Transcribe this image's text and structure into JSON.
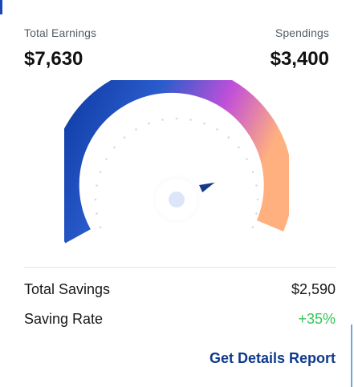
{
  "earnings": {
    "label": "Total Earnings",
    "value": "$7,630"
  },
  "spendings": {
    "label": "Spendings",
    "value": "$3,400"
  },
  "gauge": {
    "level": 0.8,
    "colors": {
      "start": "#0f3fa6",
      "mid": "#2f5fcf",
      "accent": "#c14fd8",
      "end": "#ffae80",
      "needle": "#153a8c",
      "hub": "#dfe8fa"
    }
  },
  "summary": {
    "total_savings_label": "Total Savings",
    "total_savings_value": "$2,590",
    "saving_rate_label": "Saving Rate",
    "saving_rate_value": "+35%"
  },
  "actions": {
    "details_report": "Get Details Report"
  }
}
